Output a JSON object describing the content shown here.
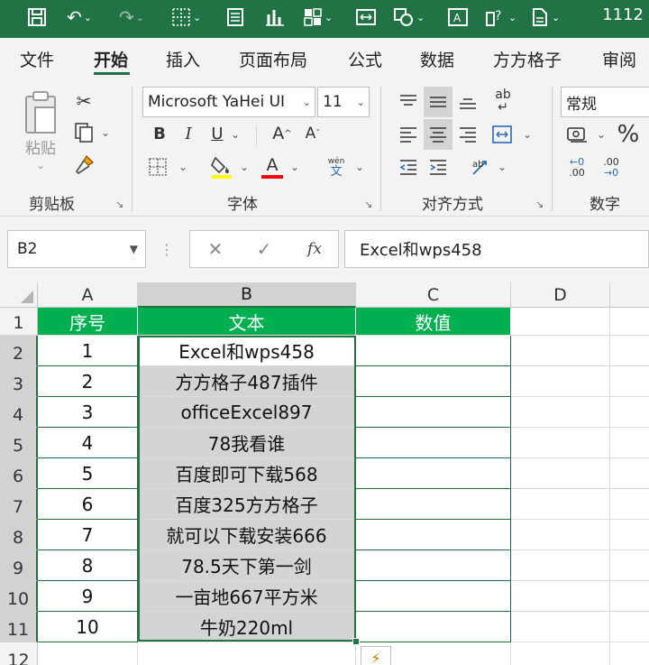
{
  "qat": {
    "title": "1112",
    "icons": [
      "save-icon",
      "undo-icon",
      "redo-icon",
      "borders-icon",
      "form-icon",
      "chart-icon",
      "grid-icon",
      "fit-icon",
      "shapes-icon",
      "textbox-icon",
      "help-icon",
      "page-icon"
    ]
  },
  "tabs": [
    "文件",
    "开始",
    "插入",
    "页面布局",
    "公式",
    "数据",
    "方方格子",
    "审阅"
  ],
  "active_tab": "开始",
  "ribbon": {
    "clipboard": {
      "label": "剪贴板",
      "paste_label": "粘贴"
    },
    "font": {
      "label": "字体",
      "font_name": "Microsoft YaHei UI",
      "font_size": "11",
      "bold": "B",
      "italic": "I",
      "underline": "U",
      "grow": "A",
      "shrink": "A",
      "color_a": "A",
      "wen": "wén",
      "wen_char": "文"
    },
    "align": {
      "label": "对齐方式",
      "wrap": "ab"
    },
    "number": {
      "label": "数字",
      "format": "常规",
      "percent": "%",
      "inc": ".00",
      "dec": ".00"
    }
  },
  "formula_bar": {
    "name_box": "B2",
    "cancel": "✕",
    "enter": "✓",
    "fx": "fx",
    "content": "Excel和wps458"
  },
  "grid": {
    "columns": [
      "A",
      "B",
      "C",
      "D"
    ],
    "rows": [
      "1",
      "2",
      "3",
      "4",
      "5",
      "6",
      "7",
      "8",
      "9",
      "10",
      "11",
      "12"
    ],
    "header": [
      "序号",
      "文本",
      "数值"
    ],
    "data": [
      [
        "1",
        "Excel和wps458"
      ],
      [
        "2",
        "方方格子487插件"
      ],
      [
        "3",
        "officeExcel897"
      ],
      [
        "4",
        "78我看谁"
      ],
      [
        "5",
        "百度即可下载568"
      ],
      [
        "6",
        "百度325方方格子"
      ],
      [
        "7",
        "就可以下载安装666"
      ],
      [
        "8",
        "78.5天下第一剑"
      ],
      [
        "9",
        "一亩地667平方米"
      ],
      [
        "10",
        "牛奶220ml"
      ]
    ]
  },
  "colors": {
    "excel_green": "#217346",
    "header_fill": "#00b050",
    "selection_fill": "#d4d4d4"
  }
}
